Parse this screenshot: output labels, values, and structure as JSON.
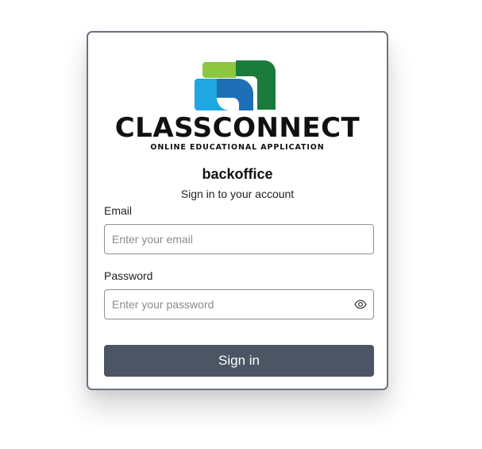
{
  "logo": {
    "wordmark": "CLASSCONNECT",
    "tagline": "ONLINE EDUCATIONAL APPLICATION",
    "colors": {
      "green_light": "#8dc63f",
      "green_dark": "#1b7b3a",
      "blue_light": "#1ea7e1",
      "blue_dark": "#1f6fb7",
      "text": "#111111"
    }
  },
  "app_name": "backoffice",
  "subtitle": "Sign in to your account",
  "form": {
    "email": {
      "label": "Email",
      "placeholder": "Enter your email",
      "value": ""
    },
    "password": {
      "label": "Password",
      "placeholder": "Enter your password",
      "value": "",
      "toggle_icon": "eye-icon"
    },
    "submit_label": "Sign in"
  },
  "theme": {
    "button_bg": "#4b5563",
    "card_border": "#6b7280"
  }
}
